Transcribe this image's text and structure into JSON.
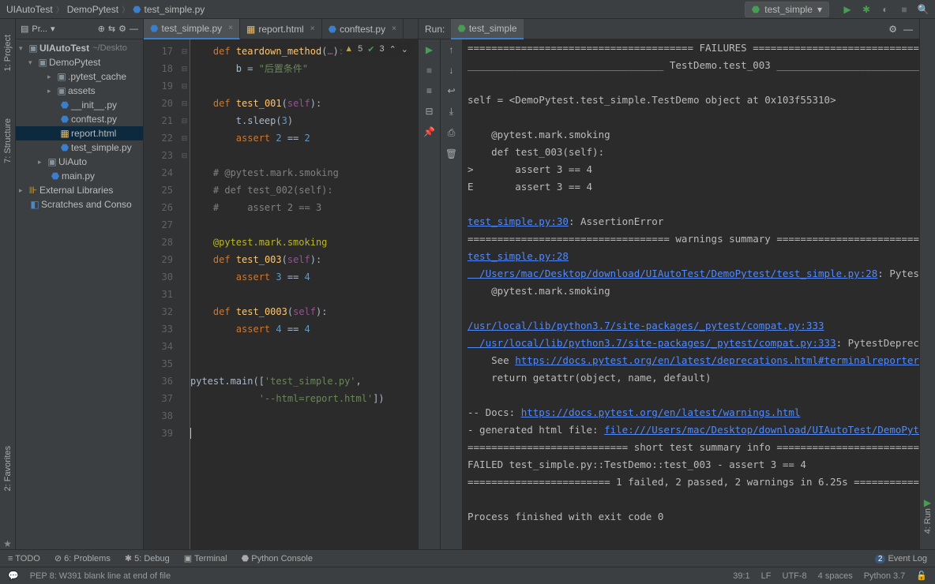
{
  "breadcrumbs": [
    "UIAutoTest",
    "DemoPytest",
    "test_simple.py"
  ],
  "runConfig": "test_simple",
  "projectTitle": "Pr...",
  "tree": {
    "root": "UIAutoTest",
    "rootHint": "~/Deskto",
    "demo": "DemoPytest",
    "cache": ".pytest_cache",
    "assets": "assets",
    "init": "__init__.py",
    "conftest": "conftest.py",
    "report": "report.html",
    "testsimple": "test_simple.py",
    "uiauto": "UiAuto",
    "main": "main.py",
    "ext": "External Libraries",
    "scratch": "Scratches and Conso"
  },
  "tabs": {
    "t1": "test_simple.py",
    "t2": "report.html",
    "t3": "conftest.py"
  },
  "inspect": {
    "warn": "5",
    "ok": "3"
  },
  "code": {
    "lines": [
      "17",
      "18",
      "19",
      "20",
      "21",
      "22",
      "23",
      "24",
      "25",
      "26",
      "27",
      "28",
      "29",
      "30",
      "31",
      "32",
      "33",
      "34",
      "35",
      "36",
      "37",
      "38",
      "39"
    ]
  },
  "runLabel": "Run:",
  "runTarget": "test_simple",
  "bottom": {
    "todo": "TODO",
    "problems": "6: Problems",
    "debug": "5: Debug",
    "terminal": "Terminal",
    "pyconsole": "Python Console",
    "eventlog": "Event Log",
    "eventcount": "2"
  },
  "status": {
    "hint": "PEP 8: W391 blank line at end of file",
    "pos": "39:1",
    "le": "LF",
    "enc": "UTF-8",
    "indent": "4 spaces",
    "sdk": "Python 3.7"
  },
  "leftTools": {
    "project": "1: Project",
    "structure": "7: Structure",
    "favorites": "2: Favorites"
  },
  "rightTools": {
    "run": "4: Run"
  },
  "console": {
    "l1": "====================================== FAILURES =======================================",
    "l2": "_________________________________ TestDemo.test_003 ___________________________________",
    "l3": "",
    "l4": "self = <DemoPytest.test_simple.TestDemo object at 0x103f55310>",
    "l5": "",
    "l6": "    @pytest.mark.smoking",
    "l7": "    def test_003(self):",
    "l8": ">       assert 3 == 4",
    "l9": "E       assert 3 == 4",
    "l10": "",
    "link1": "test_simple.py:30",
    "l11": ": AssertionError",
    "l12": "================================== warnings summary ===================================",
    "link2": "test_simple.py:28",
    "link3": "  /Users/mac/Desktop/download/UIAutoTest/DemoPytest/test_simple.py:28",
    "l13": ": Pytest",
    "l14": "    @pytest.mark.smoking",
    "l15": "",
    "link4": "/usr/local/lib/python3.7/site-packages/_pytest/compat.py:333",
    "link5": "  /usr/local/lib/python3.7/site-packages/_pytest/compat.py:333",
    "l16": ": PytestDepreca",
    "l17": "    See ",
    "link6": "https://docs.pytest.org/en/latest/deprecations.html#terminalreporter-wr",
    "l18": "    return getattr(object, name, default)",
    "l19": "",
    "l20": "-- Docs: ",
    "link7": "https://docs.pytest.org/en/latest/warnings.html",
    "l21": "- generated html file: ",
    "link8": "file:///Users/mac/Desktop/download/UIAutoTest/DemoPyte",
    "l22": "=========================== short test summary info ===========================",
    "l23": "FAILED test_simple.py::TestDemo::test_003 - assert 3 == 4",
    "l24": "======================== 1 failed, 2 passed, 2 warnings in 6.25s ========================",
    "l25": "",
    "l26": "Process finished with exit code 0"
  }
}
